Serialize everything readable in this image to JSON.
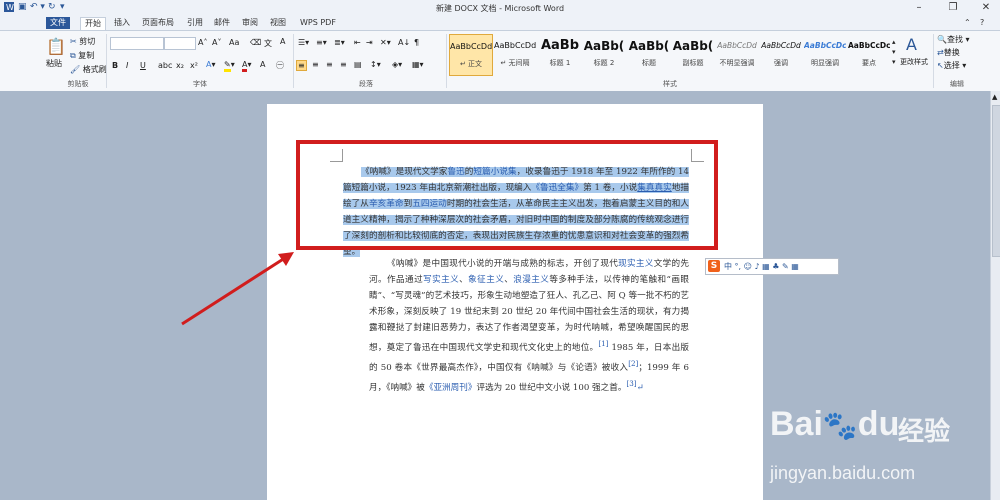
{
  "window": {
    "title": "新建 DOCX 文档 - Microsoft Word",
    "quick_access_icon": "word-app-icon",
    "min_glyph": "–",
    "max_glyph": "❐",
    "close_glyph": "✕",
    "help_glyph": "?"
  },
  "tabs": [
    {
      "label": "文件"
    },
    {
      "label": "开始"
    },
    {
      "label": "插入"
    },
    {
      "label": "页面布局"
    },
    {
      "label": "引用"
    },
    {
      "label": "邮件"
    },
    {
      "label": "审阅"
    },
    {
      "label": "视图"
    },
    {
      "label": "WPS PDF"
    }
  ],
  "clipboard": {
    "paste": "粘贴",
    "cut": "剪切",
    "copy": "复制",
    "format_painter": "格式刷",
    "group": "剪贴板"
  },
  "font": {
    "group": "字体",
    "bold": "B",
    "italic": "I",
    "underline": "U",
    "grow": "A˄",
    "shrink": "A˅",
    "aa": "Aa"
  },
  "paragraph": {
    "group": "段落",
    "sort": "A↓",
    "marks": "¶"
  },
  "styles": {
    "group": "样式",
    "items": [
      {
        "sample": "AaBbCcDd",
        "name": "↵ 正文"
      },
      {
        "sample": "AaBbCcDd",
        "name": "↵ 无间隔"
      },
      {
        "sample": "AaBb",
        "name": "标题 1"
      },
      {
        "sample": "AaBb(",
        "name": "标题 2"
      },
      {
        "sample": "AaBb(",
        "name": "标题"
      },
      {
        "sample": "AaBb(",
        "name": "副标题"
      },
      {
        "sample": "AaBbCcDd",
        "name": "不明显强调"
      },
      {
        "sample": "AaBbCcDd",
        "name": "强调"
      },
      {
        "sample": "AaBbCcDc",
        "name": "明显强调"
      },
      {
        "sample": "AaBbCcDc",
        "name": "要点"
      }
    ],
    "change_styles": "更改样式"
  },
  "editing": {
    "group": "编辑",
    "find": "查找 ▾",
    "replace": "替换",
    "select": "选择 ▾"
  },
  "document": {
    "p1": {
      "a": "《呐喊》是现代文学家",
      "l1": "鲁迅",
      "b": "的",
      "l2": "短篇小说集",
      "c": "，收录鲁迅于 1918 年至 1922 年所作的 14 篇短篇小说，1923 年由北京新潮社出版，现编入",
      "l3": "《鲁迅全集》",
      "d": "第 1 卷，小说",
      "l4": "集真真实",
      "e": "地描绘了从",
      "l5": "辛亥革命",
      "f": "到",
      "l6": "五四运动",
      "g": "时期的社会生活，从革命民主主义出发，抱着启蒙主义目的和人道主义精神，揭示了种种深层次的社会矛盾，对旧时中国的制度及部分陈腐的传统观念进行了深刻的剖析和比较彻底的否定，表现出对民族生存浓重的忧患意识和对社会变革的强烈希望。"
    },
    "p2": {
      "a": "《呐喊》是中国现代小说的开端与成熟的标志，开创了现代",
      "l1": "现实主义",
      "b": "文学的先河。作品通过",
      "l2": "写实主义",
      "c": "、",
      "l3": "象征主义",
      "d": "、",
      "l4": "浪漫主义",
      "e": "等多种手法，以传神的笔触和“画眼睛”、“写灵魂”的艺术技巧，形象生动地塑造了狂人、孔乙己、阿 Q 等一批不朽的艺术形象，深刻反映了 19 世纪末到 20 世纪 20 年代间中国社会生活的现状，有力揭露和鞭挞了封建旧恶势力，表达了作者渴望变革，为时代呐喊，希望唤醒国民的思想，奠定了鲁迅在中国现代文学史和现代文化史上的地位。",
      "ref1": "[1]",
      "f": " 1985 年，日本出版的 50 卷本《世界最高杰作》，中国仅有《呐喊》与《论语》被收入",
      "ref2": "[2]",
      "g": "；1999 年 6 月，《呐喊》被",
      "l5": "《亚洲周刊》",
      "h": "评选为 20 世纪中文小说 100 强之首。",
      "ref3": "[3]",
      "end": "↵"
    }
  },
  "ime": {
    "logo": "S",
    "items": "中 °, ☺ ♪ ▦ ♣ ✎ ▦"
  },
  "watermark": {
    "brand": "Bai",
    "paw": "du",
    "cn": "经验",
    "url": "jingyan.baidu.com"
  },
  "colors": {
    "file_tab": "#2b579a",
    "selection": "#a8c9ec",
    "highlight_box": "#d11d1d",
    "arrow": "#d11d1d"
  }
}
